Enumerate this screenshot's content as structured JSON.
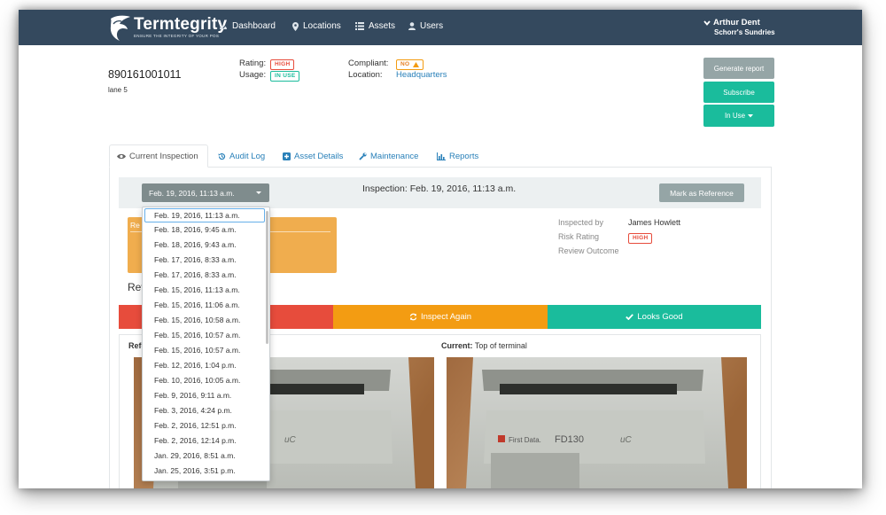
{
  "brand": {
    "name": "Termtegrity",
    "tagline": "ENSURE THE INTEGRITY OF YOUR POS"
  },
  "nav": [
    {
      "label": "Dashboard",
      "icon": "dashboard-icon"
    },
    {
      "label": "Locations",
      "icon": "map-marker-icon"
    },
    {
      "label": "Assets",
      "icon": "list-icon"
    },
    {
      "label": "Users",
      "icon": "user-icon"
    }
  ],
  "user": {
    "name": "Arthur Dent",
    "org": "Schorr's Sundries"
  },
  "asset": {
    "id": "890161001011",
    "subtitle": "lane 5",
    "rating_label": "Rating:",
    "rating_value": "HIGH",
    "usage_label": "Usage:",
    "usage_value": "IN USE",
    "compliant_label": "Compliant:",
    "compliant_value": "NO",
    "location_label": "Location:",
    "location_value": "Headquarters"
  },
  "actions": {
    "generate_report": "Generate report",
    "subscribe": "Subscribe",
    "in_use": "In Use"
  },
  "tabs": [
    {
      "label": "Current Inspection",
      "icon": "eye-icon",
      "active": true
    },
    {
      "label": "Audit Log",
      "icon": "history-icon",
      "active": false
    },
    {
      "label": "Asset Details",
      "icon": "plus-square-icon",
      "active": false
    },
    {
      "label": "Maintenance",
      "icon": "wrench-icon",
      "active": false
    },
    {
      "label": "Reports",
      "icon": "bar-chart-icon",
      "active": false
    }
  ],
  "inspection": {
    "selected_date": "Feb. 19, 2016, 11:13 a.m.",
    "title": "Inspection: Feb. 19, 2016, 11:13 a.m.",
    "mark_reference": "Mark as Reference",
    "inspected_by_label": "Inspected by",
    "inspected_by_value": "James Howlett",
    "risk_rating_label": "Risk Rating",
    "risk_rating_value": "HIGH",
    "review_outcome_label": "Review Outcome",
    "reason_title": "Re",
    "review_label": "Rev",
    "inspect_again": "Inspect Again",
    "looks_good": "Looks Good",
    "reference_label": "Refe",
    "current_label": "Current:",
    "current_value": "Top of terminal"
  },
  "dates": [
    "Feb. 19, 2016, 11:13 a.m.",
    "Feb. 18, 2016, 9:45 a.m.",
    "Feb. 18, 2016, 9:43 a.m.",
    "Feb. 17, 2016, 8:33 a.m.",
    "Feb. 17, 2016, 8:33 a.m.",
    "Feb. 15, 2016, 11:13 a.m.",
    "Feb. 15, 2016, 11:06 a.m.",
    "Feb. 15, 2016, 10:58 a.m.",
    "Feb. 15, 2016, 10:57 a.m.",
    "Feb. 15, 2016, 10:57 a.m.",
    "Feb. 12, 2016, 1:04 p.m.",
    "Feb. 10, 2016, 10:05 a.m.",
    "Feb. 9, 2016, 9:11 a.m.",
    "Feb. 3, 2016, 4:24 p.m.",
    "Feb. 2, 2016, 12:51 p.m.",
    "Feb. 2, 2016, 12:14 p.m.",
    "Jan. 29, 2016, 8:51 a.m.",
    "Jan. 25, 2016, 3:51 p.m."
  ],
  "photo": {
    "terminal_brand": "First Data.",
    "terminal_model": "FD130",
    "terminal_suffix": "uC"
  },
  "colors": {
    "navbar": "#34495e",
    "accent": "#1abc9c",
    "danger": "#e74c3c",
    "warning": "#f39c12",
    "link": "#2980b9"
  }
}
